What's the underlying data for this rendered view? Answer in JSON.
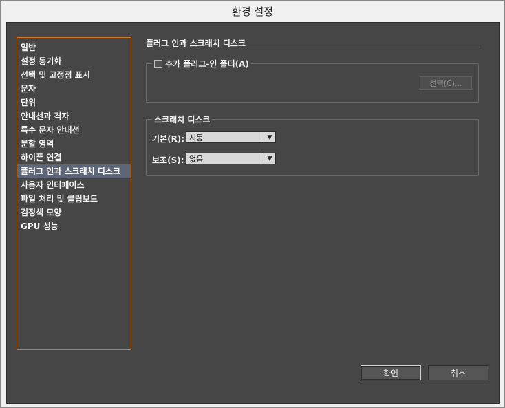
{
  "window": {
    "title": "환경 설정"
  },
  "sidebar": {
    "items": [
      {
        "label": "일반"
      },
      {
        "label": "설정 동기화"
      },
      {
        "label": "선택 및 고정점 표시"
      },
      {
        "label": "문자"
      },
      {
        "label": "단위"
      },
      {
        "label": "안내선과 격자"
      },
      {
        "label": "특수 문자 안내선"
      },
      {
        "label": "분할 영역"
      },
      {
        "label": "하이픈 연결"
      },
      {
        "label": "플러그 인과 스크래치 디스크",
        "selected": true
      },
      {
        "label": "사용자 인터페이스"
      },
      {
        "label": "파일 처리 및 클립보드"
      },
      {
        "label": "검정색 모양"
      },
      {
        "label": "GPU 성능"
      }
    ]
  },
  "main": {
    "section_title": "플러그 인과 스크래치 디스크",
    "plugins_group": {
      "checkbox_label": "추가 플러그-인 폴더(A)",
      "checked": false,
      "choose_button": "선택(C)..."
    },
    "scratch_group": {
      "title": "스크래치 디스크",
      "primary_label": "기본(R):",
      "primary_value": "시동",
      "secondary_label": "보조(S):",
      "secondary_value": "없음"
    }
  },
  "footer": {
    "ok_label": "확인",
    "cancel_label": "취소"
  },
  "colors": {
    "panel": "#464646",
    "selection": "#5c6676",
    "sidebar_border": "#d27b22"
  }
}
